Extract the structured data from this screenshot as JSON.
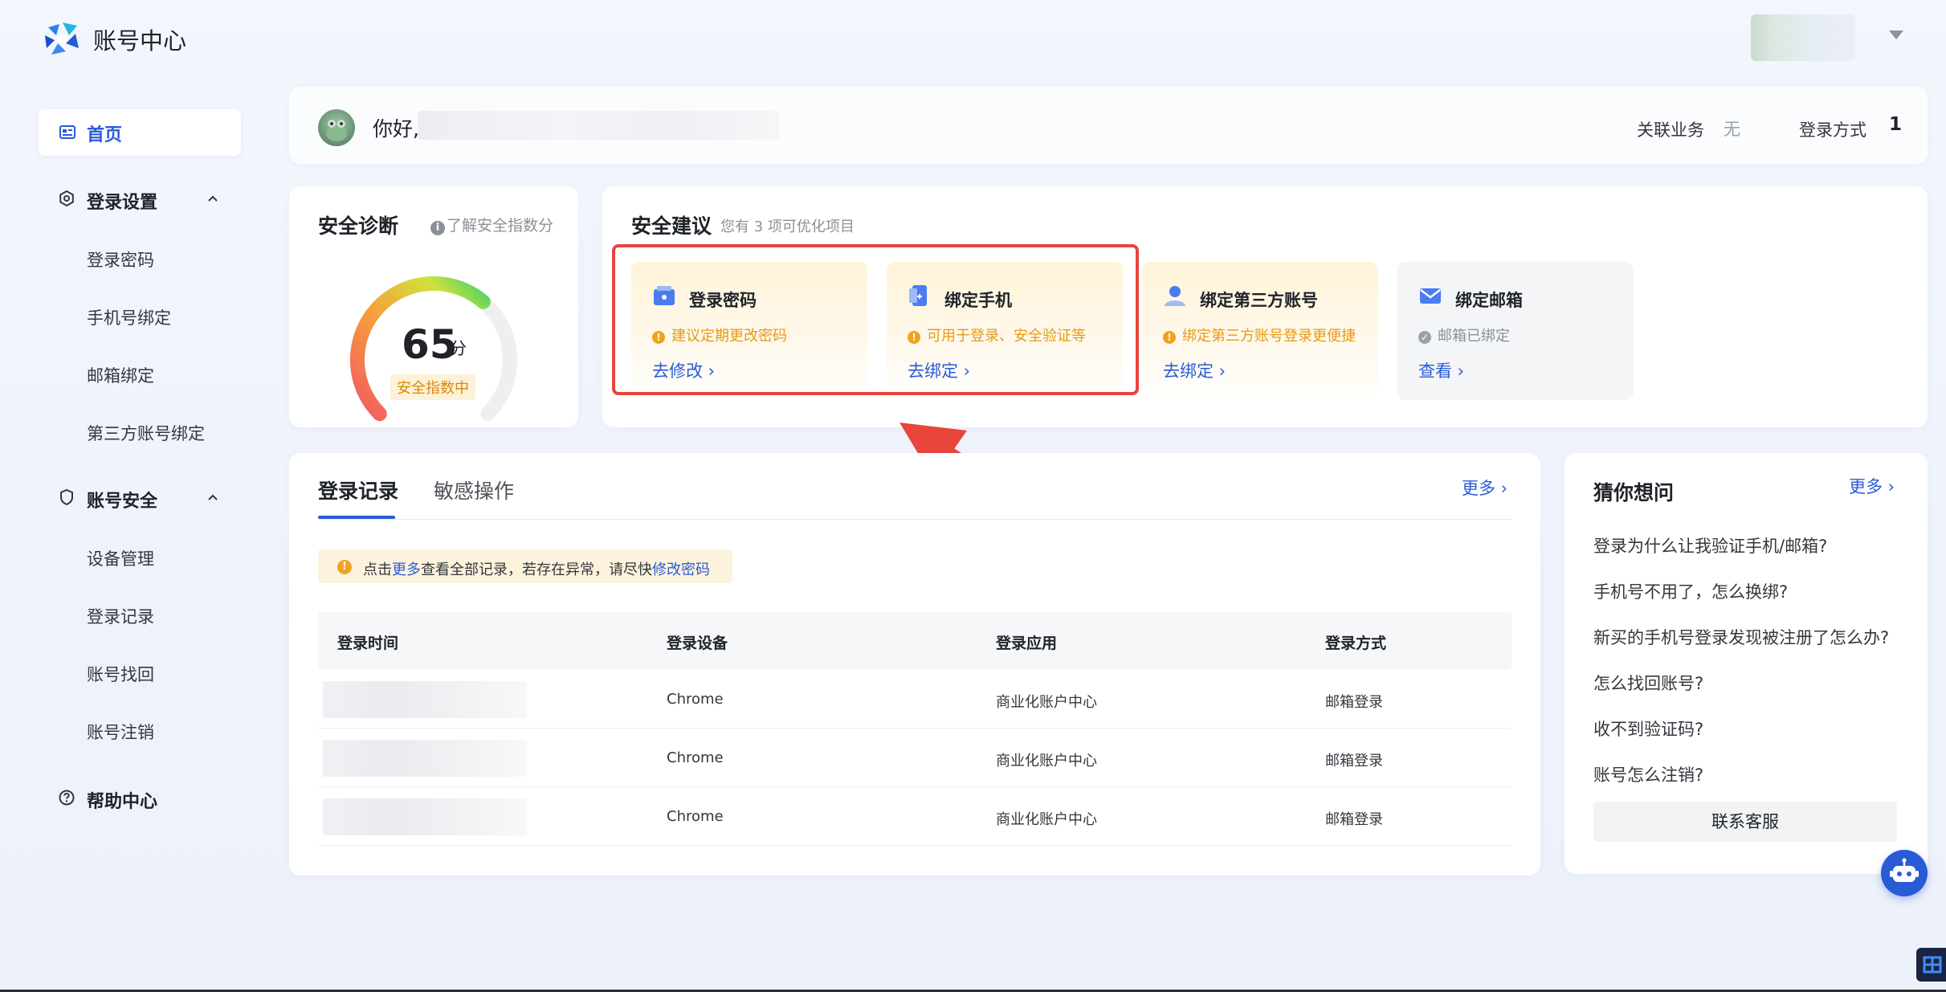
{
  "header": {
    "brand": "账号中心"
  },
  "sidebar": {
    "home": "首页",
    "groups": [
      {
        "label": "登录设置",
        "items": [
          "登录密码",
          "手机号绑定",
          "邮箱绑定",
          "第三方账号绑定"
        ]
      },
      {
        "label": "账号安全",
        "items": [
          "设备管理",
          "登录记录",
          "账号找回",
          "账号注销"
        ]
      },
      {
        "label": "帮助中心",
        "items": []
      }
    ]
  },
  "greeting": {
    "hello": "你好,",
    "linked_label": "关联业务",
    "linked_value": "无",
    "login_method_label": "登录方式",
    "login_method_value": "1"
  },
  "diagnosis": {
    "title": "安全诊断",
    "link": "了解安全指数分",
    "score": "65",
    "unit": "分",
    "badge": "安全指数中",
    "score_fraction": 0.65
  },
  "advice": {
    "title": "安全建议",
    "subtitle": "您有 3 项可优化项目",
    "items": [
      {
        "title": "登录密码",
        "note": "建议定期更改密码",
        "link": "去修改"
      },
      {
        "title": "绑定手机",
        "note": "可用于登录、安全验证等",
        "link": "去绑定"
      },
      {
        "title": "绑定第三方账号",
        "note": "绑定第三方账号登录更便捷",
        "link": "去绑定"
      },
      {
        "title": "绑定邮箱",
        "note": "邮箱已绑定",
        "link": "查看"
      }
    ]
  },
  "records": {
    "tabs": [
      "登录记录",
      "敏感操作"
    ],
    "more": "更多",
    "notice_prefix": "点击",
    "notice_more": "更多",
    "notice_mid": "查看全部记录，若存在异常，请尽快",
    "notice_link": "修改密码",
    "columns": [
      "登录时间",
      "登录设备",
      "登录应用",
      "登录方式"
    ],
    "rows": [
      {
        "device": "Chrome",
        "app": "商业化账户中心",
        "method": "邮箱登录"
      },
      {
        "device": "Chrome",
        "app": "商业化账户中心",
        "method": "邮箱登录"
      },
      {
        "device": "Chrome",
        "app": "商业化账户中心",
        "method": "邮箱登录"
      }
    ]
  },
  "faq": {
    "title": "猜你想问",
    "more": "更多",
    "items": [
      "登录为什么让我验证手机/邮箱?",
      "手机号不用了，怎么换绑?",
      "新买的手机号登录发现被注册了怎么办?",
      "怎么找回账号?",
      "收不到验证码?",
      "账号怎么注销?"
    ],
    "button": "联系客服"
  },
  "colors": {
    "accent": "#2a5bd7",
    "warning": "#f0a220",
    "highlight": "#e8453c"
  }
}
